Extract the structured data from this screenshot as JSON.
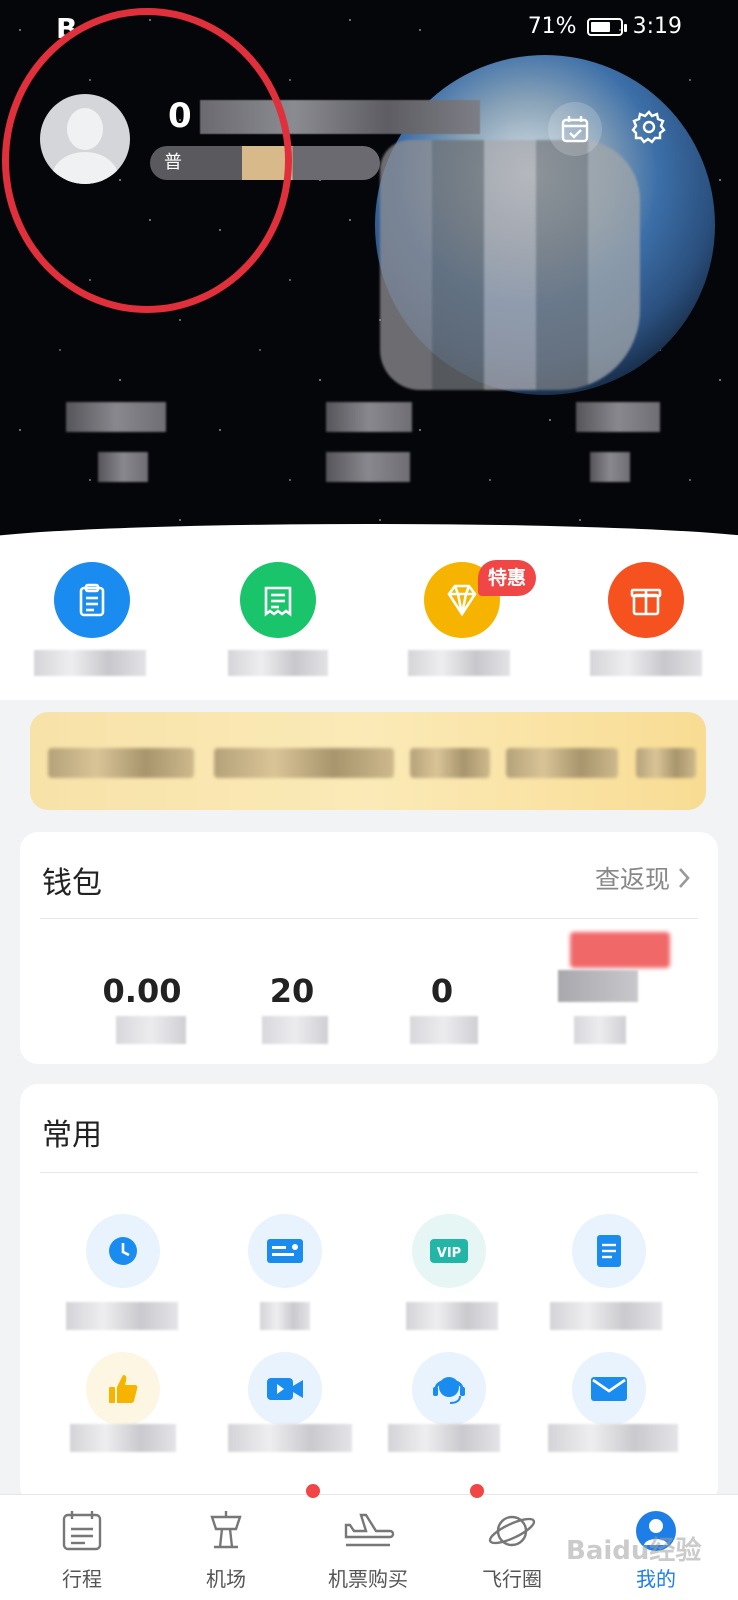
{
  "status_bar": {
    "left_text": "B",
    "battery_percent": "71%",
    "battery_level": 0.71,
    "time": "3:19"
  },
  "profile": {
    "username_prefix": "0",
    "member_prefix": "普"
  },
  "quick_actions": {
    "badge": "特惠",
    "items": [
      {
        "icon": "clipboard-icon",
        "color": "#1a8cf0"
      },
      {
        "icon": "receipt-icon",
        "color": "#19c46a"
      },
      {
        "icon": "diamond-icon",
        "color": "#f6b400"
      },
      {
        "icon": "gift-icon",
        "color": "#f5521f"
      }
    ]
  },
  "wallet": {
    "title": "钱包",
    "link": "查返现",
    "values": [
      "0.00",
      "20",
      "0"
    ]
  },
  "common": {
    "title": "常用"
  },
  "tabbar": {
    "items": [
      {
        "label": "行程",
        "icon": "itinerary-icon"
      },
      {
        "label": "机场",
        "icon": "airport-icon"
      },
      {
        "label": "机票购买",
        "icon": "plane-ticket-icon"
      },
      {
        "label": "飞行圈",
        "icon": "planet-icon"
      },
      {
        "label": "我的",
        "icon": "profile-icon",
        "active": true
      }
    ]
  },
  "watermark": "Baidu经验",
  "colors": {
    "accent": "#1e7ee8",
    "annotation": "#e0303c",
    "badge": "#f04646"
  }
}
